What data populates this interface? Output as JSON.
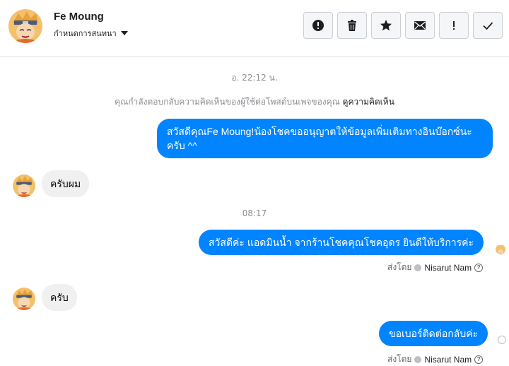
{
  "header": {
    "contact_name": "Fe Moung",
    "settings_label": "กำหนดการสนทนา"
  },
  "actions": [
    {
      "name": "report-button",
      "icon": "alert-circle-icon"
    },
    {
      "name": "delete-button",
      "icon": "trash-icon"
    },
    {
      "name": "star-button",
      "icon": "star-icon"
    },
    {
      "name": "mark-unread-button",
      "icon": "envelope-icon"
    },
    {
      "name": "important-button",
      "icon": "exclamation-icon"
    },
    {
      "name": "mark-done-button",
      "icon": "check-icon"
    }
  ],
  "conversation": {
    "timestamp_1": "อ. 22:12 น.",
    "notice_text": "คุณกำลังตอบกลับความคิดเห็นของผู้ใช้ต่อโพสต์บนเพจของคุณ",
    "notice_link": "ดูความคิดเห็น",
    "msg_1_out": "สวัสดีคุณFe Moung!น้องโชคขออนุญาตให้ข้อมูลเพิ่มเติมทางอินบ๊อกซ์นะครับ ^^",
    "msg_2_in": "ครับผม",
    "timestamp_2": "08:17",
    "msg_3_out": "สวัสดีค่ะ แอดมินน้ำ จากร้านโชคคุณโชคอุดร ยินดีให้บริการค่ะ",
    "sent_by_label": "ส่งโดย",
    "sent_by_name": "Nisarut Nam",
    "msg_4_in": "ครับ",
    "msg_5_out": "ขอเบอร์ติดต่อกลับค่ะ"
  },
  "colors": {
    "accent": "#0084ff",
    "incoming_bubble": "#f0f0f0"
  }
}
